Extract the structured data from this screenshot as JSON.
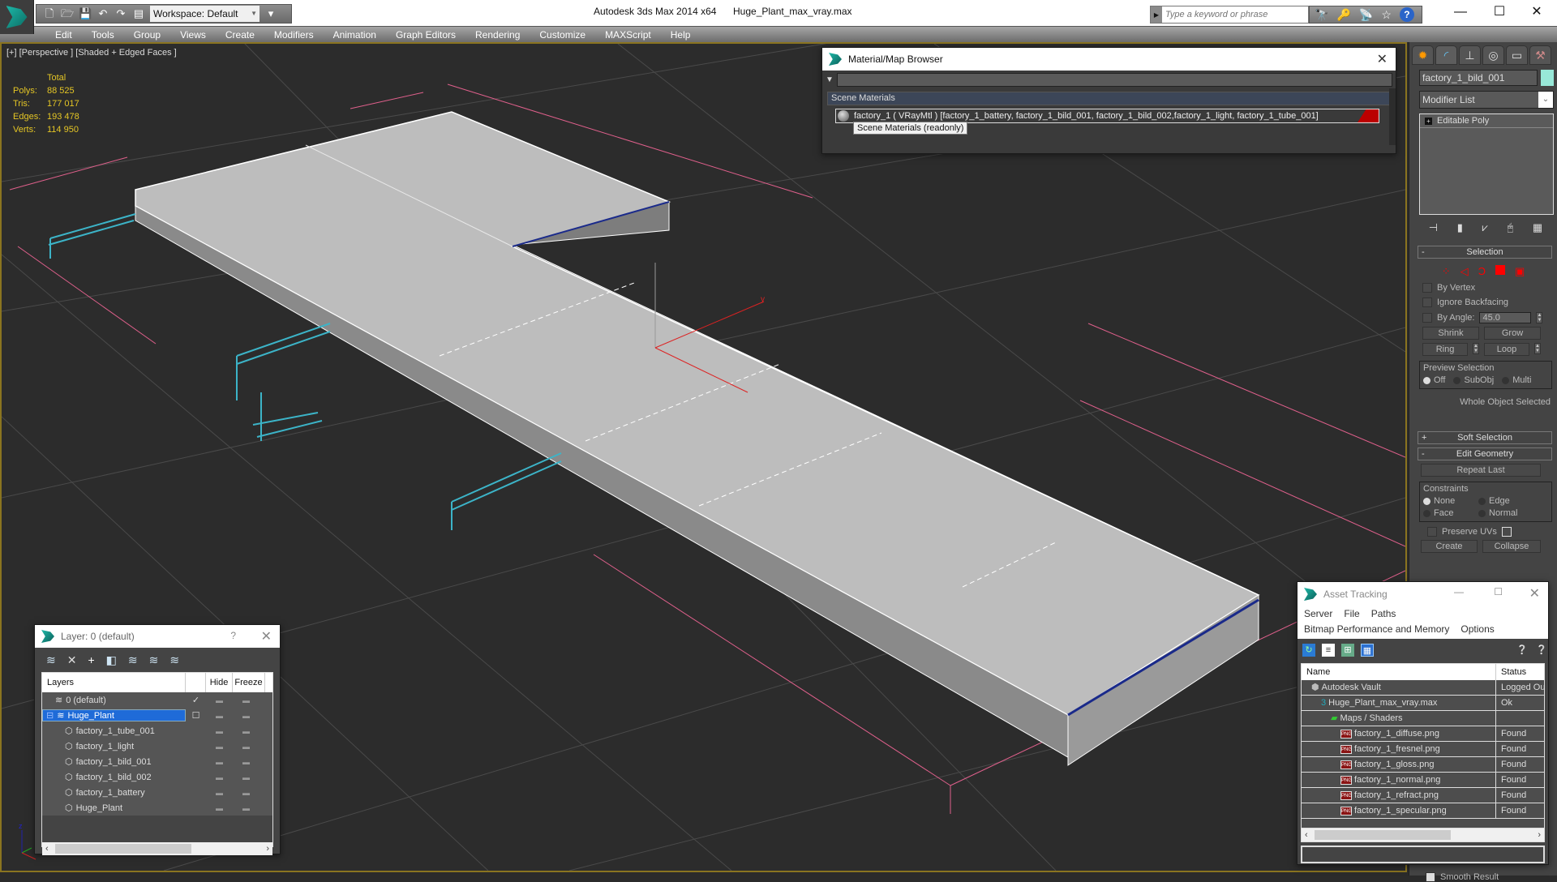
{
  "window": {
    "app_title": "Autodesk 3ds Max  2014 x64",
    "file_name": "Huge_Plant_max_vray.max",
    "workspace": "Workspace: Default",
    "search_placeholder": "Type a keyword or phrase"
  },
  "menubar": [
    "Edit",
    "Tools",
    "Group",
    "Views",
    "Create",
    "Modifiers",
    "Animation",
    "Graph Editors",
    "Rendering",
    "Customize",
    "MAXScript",
    "Help"
  ],
  "viewport": {
    "label": "[+] [Perspective ] [Shaded + Edged Faces ]",
    "stats": {
      "header": "Total",
      "rows": [
        {
          "key": "Polys:",
          "value": "88 525"
        },
        {
          "key": "Tris:",
          "value": "177 017"
        },
        {
          "key": "Edges:",
          "value": "193 478"
        },
        {
          "key": "Verts:",
          "value": "114 950"
        }
      ]
    },
    "axis_labels": {
      "z": "z",
      "y": "y"
    }
  },
  "command_panel": {
    "tabs": [
      "create",
      "modify",
      "hierarchy",
      "motion",
      "display",
      "utilities"
    ],
    "object_name": "factory_1_bild_001",
    "object_color": "#98e8d8",
    "modifier_list": "Modifier List",
    "stack": [
      {
        "label": "Editable Poly"
      }
    ],
    "selection": {
      "title": "Selection",
      "by_vertex": "By Vertex",
      "ignore_backfacing": "Ignore Backfacing",
      "by_angle": "By Angle:",
      "angle_value": "45.0",
      "shrink": "Shrink",
      "grow": "Grow",
      "ring": "Ring",
      "loop": "Loop",
      "preview_title": "Preview Selection",
      "preview_options": [
        "Off",
        "SubObj",
        "Multi"
      ],
      "preview_selected": "Off",
      "status": "Whole Object Selected"
    },
    "soft_selection": "Soft Selection",
    "edit_geometry": {
      "title": "Edit Geometry",
      "repeat_last": "Repeat Last",
      "constraints_title": "Constraints",
      "constraints": [
        "None",
        "Edge",
        "Face",
        "Normal"
      ],
      "constraint_selected": "None",
      "preserve_uvs": "Preserve UVs",
      "create": "Create",
      "collapse": "Collapse"
    },
    "smooth_result": "Smooth Result"
  },
  "material_browser": {
    "title": "Material/Map Browser",
    "section": "Scene Materials",
    "entry": "factory_1 ( VRayMtl ) [factory_1_battery, factory_1_bild_001, factory_1_bild_002,factory_1_light, factory_1_tube_001]",
    "tooltip": "Scene Materials (readonly)"
  },
  "layer_dialog": {
    "title": "Layer: 0 (default)",
    "help": "?",
    "columns": [
      "Layers",
      "",
      "Hide",
      "Freeze"
    ],
    "rows": [
      {
        "name": "0 (default)",
        "type": "layer",
        "active": "✓",
        "selected": false,
        "indent": 1
      },
      {
        "name": "Huge_Plant",
        "type": "layer",
        "active": "☐",
        "selected": true,
        "indent": 0
      },
      {
        "name": "factory_1_tube_001",
        "type": "object",
        "active": "",
        "selected": false,
        "indent": 2
      },
      {
        "name": "factory_1_light",
        "type": "object",
        "active": "",
        "selected": false,
        "indent": 2
      },
      {
        "name": "factory_1_bild_001",
        "type": "object",
        "active": "",
        "selected": false,
        "indent": 2
      },
      {
        "name": "factory_1_bild_002",
        "type": "object",
        "active": "",
        "selected": false,
        "indent": 2
      },
      {
        "name": "factory_1_battery",
        "type": "object",
        "active": "",
        "selected": false,
        "indent": 2
      },
      {
        "name": "Huge_Plant",
        "type": "object",
        "active": "",
        "selected": false,
        "indent": 2
      }
    ]
  },
  "asset_tracking": {
    "title": "Asset Tracking",
    "menu_row1": [
      "Server",
      "File",
      "Paths"
    ],
    "menu_row2": [
      "Bitmap Performance and Memory",
      "Options"
    ],
    "columns": [
      "Name",
      "Status"
    ],
    "rows": [
      {
        "name": "Autodesk Vault",
        "status": "Logged Out",
        "icon": "vault",
        "indent": 1
      },
      {
        "name": "Huge_Plant_max_vray.max",
        "status": "Ok",
        "icon": "max",
        "indent": 2
      },
      {
        "name": "Maps / Shaders",
        "status": "",
        "icon": "maps",
        "indent": 3
      },
      {
        "name": "factory_1_diffuse.png",
        "status": "Found",
        "icon": "png",
        "indent": 4
      },
      {
        "name": "factory_1_fresnel.png",
        "status": "Found",
        "icon": "png",
        "indent": 4
      },
      {
        "name": "factory_1_gloss.png",
        "status": "Found",
        "icon": "png",
        "indent": 4
      },
      {
        "name": "factory_1_normal.png",
        "status": "Found",
        "icon": "png",
        "indent": 4
      },
      {
        "name": "factory_1_refract.png",
        "status": "Found",
        "icon": "png",
        "indent": 4
      },
      {
        "name": "factory_1_specular.png",
        "status": "Found",
        "icon": "png",
        "indent": 4
      }
    ]
  }
}
